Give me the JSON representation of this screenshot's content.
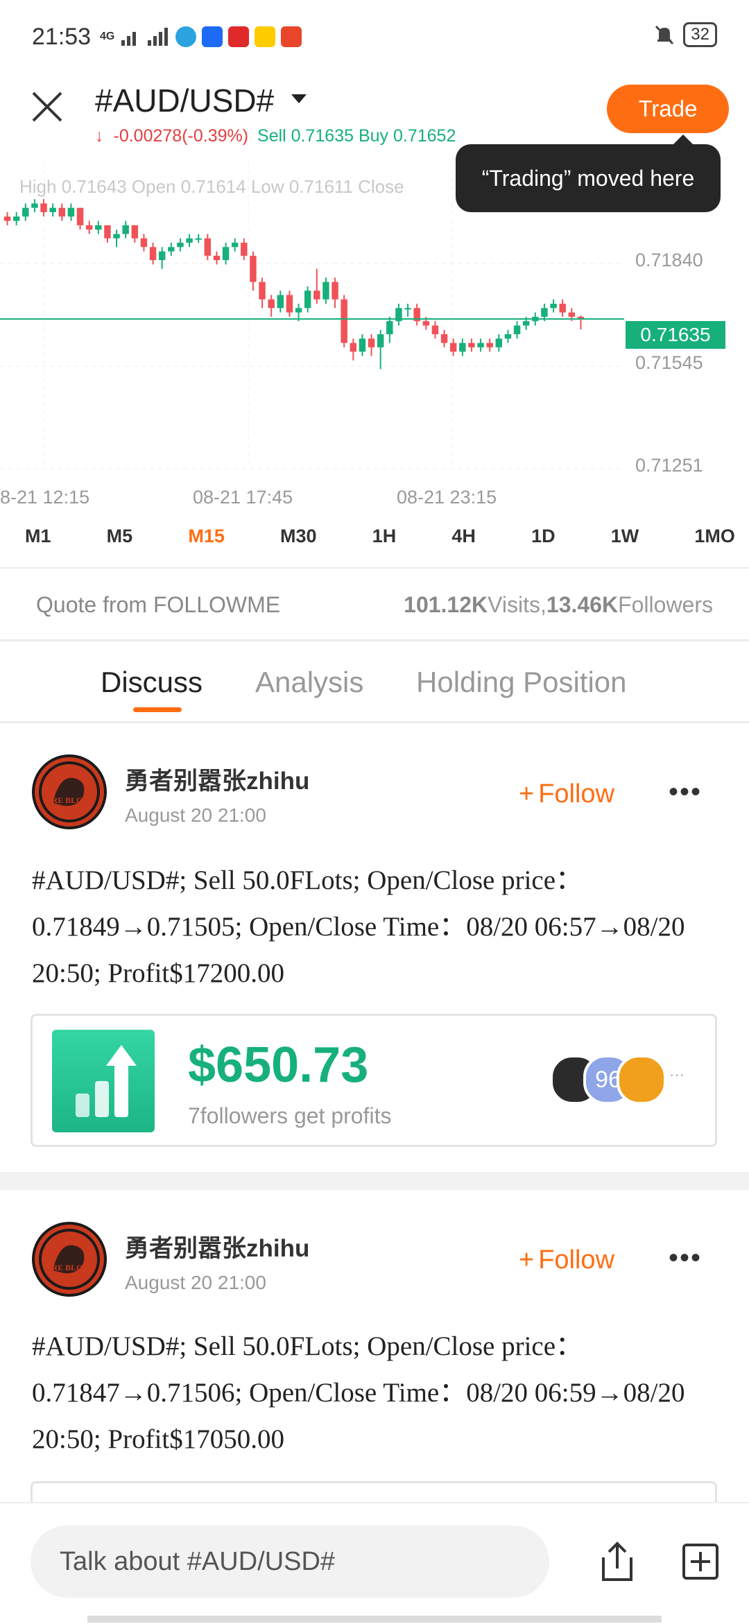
{
  "status_bar": {
    "time": "21:53",
    "network": "4G",
    "battery": "32",
    "app_icons": [
      {
        "name": "telegram-icon",
        "color": "#2aa3df"
      },
      {
        "name": "zalo-icon",
        "color": "#1d6af5"
      },
      {
        "name": "app-red-icon",
        "color": "#e02a2a"
      },
      {
        "name": "app-yellow-icon",
        "color": "#ffcc00"
      },
      {
        "name": "app-b-icon",
        "color": "#e8452a"
      }
    ]
  },
  "header": {
    "title": "#AUD/USD#",
    "change": "-0.00278(-0.39%)",
    "sell_buy": "Sell 0.71635 Buy 0.71652",
    "trade_label": "Trade",
    "tooltip": "“Trading” moved here"
  },
  "chart": {
    "ohlc_line": "High 0.71643  Open 0.71614  Low 0.71611  Close",
    "price_ticks": [
      "0.71840",
      "0.71545",
      "0.71251"
    ],
    "current_price": "0.71635",
    "time_ticks": [
      "8-21 12:15",
      "08-21 17:45",
      "08-21 23:15"
    ],
    "up_color": "#17b07b",
    "down_color": "#f05258"
  },
  "chart_data": {
    "type": "candlestick",
    "title": "",
    "x": [
      "08-21 12:15",
      "08-21 17:45",
      "08-21 23:15"
    ],
    "ylim": [
      0.7125,
      0.7195
    ],
    "current_price": 0.71635,
    "candles": [
      {
        "o": 0.7187,
        "c": 0.7186,
        "h": 0.7188,
        "l": 0.7185
      },
      {
        "o": 0.7186,
        "c": 0.7187,
        "h": 0.7188,
        "l": 0.7185
      },
      {
        "o": 0.7187,
        "c": 0.7189,
        "h": 0.719,
        "l": 0.7186
      },
      {
        "o": 0.7189,
        "c": 0.719,
        "h": 0.7191,
        "l": 0.7188
      },
      {
        "o": 0.719,
        "c": 0.7188,
        "h": 0.7191,
        "l": 0.7187
      },
      {
        "o": 0.7188,
        "c": 0.7189,
        "h": 0.719,
        "l": 0.7187
      },
      {
        "o": 0.7189,
        "c": 0.7187,
        "h": 0.719,
        "l": 0.7186
      },
      {
        "o": 0.7187,
        "c": 0.7189,
        "h": 0.719,
        "l": 0.7186
      },
      {
        "o": 0.7189,
        "c": 0.7185,
        "h": 0.7189,
        "l": 0.7184
      },
      {
        "o": 0.7185,
        "c": 0.7184,
        "h": 0.7186,
        "l": 0.7183
      },
      {
        "o": 0.7184,
        "c": 0.7185,
        "h": 0.7186,
        "l": 0.7183
      },
      {
        "o": 0.7185,
        "c": 0.7182,
        "h": 0.7185,
        "l": 0.7181
      },
      {
        "o": 0.7182,
        "c": 0.7183,
        "h": 0.7184,
        "l": 0.718
      },
      {
        "o": 0.7183,
        "c": 0.7185,
        "h": 0.7186,
        "l": 0.7182
      },
      {
        "o": 0.7185,
        "c": 0.7182,
        "h": 0.7185,
        "l": 0.7181
      },
      {
        "o": 0.7182,
        "c": 0.718,
        "h": 0.7183,
        "l": 0.7179
      },
      {
        "o": 0.718,
        "c": 0.7177,
        "h": 0.7181,
        "l": 0.7176
      },
      {
        "o": 0.7177,
        "c": 0.7179,
        "h": 0.718,
        "l": 0.7175
      },
      {
        "o": 0.7179,
        "c": 0.718,
        "h": 0.7181,
        "l": 0.7178
      },
      {
        "o": 0.718,
        "c": 0.7181,
        "h": 0.7182,
        "l": 0.7179
      },
      {
        "o": 0.7181,
        "c": 0.7182,
        "h": 0.7183,
        "l": 0.718
      },
      {
        "o": 0.7182,
        "c": 0.7182,
        "h": 0.7183,
        "l": 0.7181
      },
      {
        "o": 0.7182,
        "c": 0.7178,
        "h": 0.7183,
        "l": 0.7177
      },
      {
        "o": 0.7178,
        "c": 0.7177,
        "h": 0.7179,
        "l": 0.7176
      },
      {
        "o": 0.7177,
        "c": 0.718,
        "h": 0.7181,
        "l": 0.7176
      },
      {
        "o": 0.718,
        "c": 0.7181,
        "h": 0.7182,
        "l": 0.7179
      },
      {
        "o": 0.7181,
        "c": 0.7178,
        "h": 0.7182,
        "l": 0.7177
      },
      {
        "o": 0.7178,
        "c": 0.7172,
        "h": 0.7179,
        "l": 0.717
      },
      {
        "o": 0.7172,
        "c": 0.7168,
        "h": 0.7173,
        "l": 0.7166
      },
      {
        "o": 0.7168,
        "c": 0.7166,
        "h": 0.7169,
        "l": 0.7164
      },
      {
        "o": 0.7166,
        "c": 0.7169,
        "h": 0.717,
        "l": 0.7165
      },
      {
        "o": 0.7169,
        "c": 0.7165,
        "h": 0.717,
        "l": 0.7164
      },
      {
        "o": 0.7165,
        "c": 0.7166,
        "h": 0.7167,
        "l": 0.7163
      },
      {
        "o": 0.7166,
        "c": 0.717,
        "h": 0.7171,
        "l": 0.7165
      },
      {
        "o": 0.717,
        "c": 0.7168,
        "h": 0.7175,
        "l": 0.7167
      },
      {
        "o": 0.7168,
        "c": 0.7172,
        "h": 0.7173,
        "l": 0.7167
      },
      {
        "o": 0.7172,
        "c": 0.7168,
        "h": 0.7173,
        "l": 0.7166
      },
      {
        "o": 0.7168,
        "c": 0.7158,
        "h": 0.7169,
        "l": 0.7157
      },
      {
        "o": 0.7158,
        "c": 0.7156,
        "h": 0.7159,
        "l": 0.7154
      },
      {
        "o": 0.7156,
        "c": 0.7159,
        "h": 0.716,
        "l": 0.7155
      },
      {
        "o": 0.7159,
        "c": 0.7157,
        "h": 0.716,
        "l": 0.7155
      },
      {
        "o": 0.7157,
        "c": 0.716,
        "h": 0.7161,
        "l": 0.7152
      },
      {
        "o": 0.716,
        "c": 0.7163,
        "h": 0.7164,
        "l": 0.7158
      },
      {
        "o": 0.7163,
        "c": 0.7166,
        "h": 0.7167,
        "l": 0.7162
      },
      {
        "o": 0.7166,
        "c": 0.7166,
        "h": 0.7167,
        "l": 0.7164
      },
      {
        "o": 0.7166,
        "c": 0.7163,
        "h": 0.7167,
        "l": 0.7162
      },
      {
        "o": 0.7163,
        "c": 0.7162,
        "h": 0.7164,
        "l": 0.7161
      },
      {
        "o": 0.7162,
        "c": 0.716,
        "h": 0.7163,
        "l": 0.7159
      },
      {
        "o": 0.716,
        "c": 0.7158,
        "h": 0.7161,
        "l": 0.7157
      },
      {
        "o": 0.7158,
        "c": 0.7156,
        "h": 0.7159,
        "l": 0.7155
      },
      {
        "o": 0.7156,
        "c": 0.7158,
        "h": 0.7159,
        "l": 0.7155
      },
      {
        "o": 0.7158,
        "c": 0.7157,
        "h": 0.7159,
        "l": 0.7156
      },
      {
        "o": 0.7157,
        "c": 0.7158,
        "h": 0.7159,
        "l": 0.7156
      },
      {
        "o": 0.7158,
        "c": 0.7157,
        "h": 0.7159,
        "l": 0.7156
      },
      {
        "o": 0.7157,
        "c": 0.7159,
        "h": 0.716,
        "l": 0.7156
      },
      {
        "o": 0.7159,
        "c": 0.716,
        "h": 0.7161,
        "l": 0.7158
      },
      {
        "o": 0.716,
        "c": 0.7162,
        "h": 0.7163,
        "l": 0.7159
      },
      {
        "o": 0.7162,
        "c": 0.7163,
        "h": 0.7164,
        "l": 0.7161
      },
      {
        "o": 0.7163,
        "c": 0.7164,
        "h": 0.7165,
        "l": 0.7162
      },
      {
        "o": 0.7164,
        "c": 0.7166,
        "h": 0.7167,
        "l": 0.7163
      },
      {
        "o": 0.7166,
        "c": 0.7167,
        "h": 0.7168,
        "l": 0.7165
      },
      {
        "o": 0.7167,
        "c": 0.7165,
        "h": 0.7168,
        "l": 0.7164
      },
      {
        "o": 0.7165,
        "c": 0.7164,
        "h": 0.7166,
        "l": 0.7163
      },
      {
        "o": 0.7164,
        "c": 0.71635,
        "h": 0.71643,
        "l": 0.71611
      }
    ]
  },
  "timeframes": [
    {
      "label": "M1",
      "active": false
    },
    {
      "label": "M5",
      "active": false
    },
    {
      "label": "M15",
      "active": true
    },
    {
      "label": "M30",
      "active": false
    },
    {
      "label": "1H",
      "active": false
    },
    {
      "label": "4H",
      "active": false
    },
    {
      "label": "1D",
      "active": false
    },
    {
      "label": "1W",
      "active": false
    },
    {
      "label": "1MO",
      "active": false
    }
  ],
  "quote_bar": {
    "source": "Quote from FOLLOWME",
    "visits": "101.12K",
    "visits_label": "Visits,",
    "followers": "13.46K",
    "followers_label": "Followers"
  },
  "tabs": [
    "Discuss",
    "Analysis",
    "Holding Position"
  ],
  "posts": [
    {
      "username": "勇者别嚣张zhihu",
      "date": "August 20 21:00",
      "follow_label": "Follow",
      "body": "#AUD/USD#; Sell 50.0FLots; Open/Close price：0.71849→0.71505; Open/Close Time：08/20 06:57→08/20 20:50; Profit$17200.00",
      "profit_amount": "$650.73",
      "profit_sub": "7followers get profits",
      "follower_badge": "96"
    },
    {
      "username": "勇者别嚣张zhihu",
      "date": "August 20 21:00",
      "follow_label": "Follow",
      "body": "#AUD/USD#; Sell 50.0FLots; Open/Close price：0.71847→0.71506; Open/Close Time：08/20 06:59→08/20 20:50; Profit$17050.00"
    }
  ],
  "avatar_text": "FIRE BLOOD",
  "composer": {
    "placeholder": "Talk about #AUD/USD#"
  },
  "colors": {
    "accent": "#ff6d12",
    "green": "#17b07b",
    "red": "#e53e3e"
  }
}
